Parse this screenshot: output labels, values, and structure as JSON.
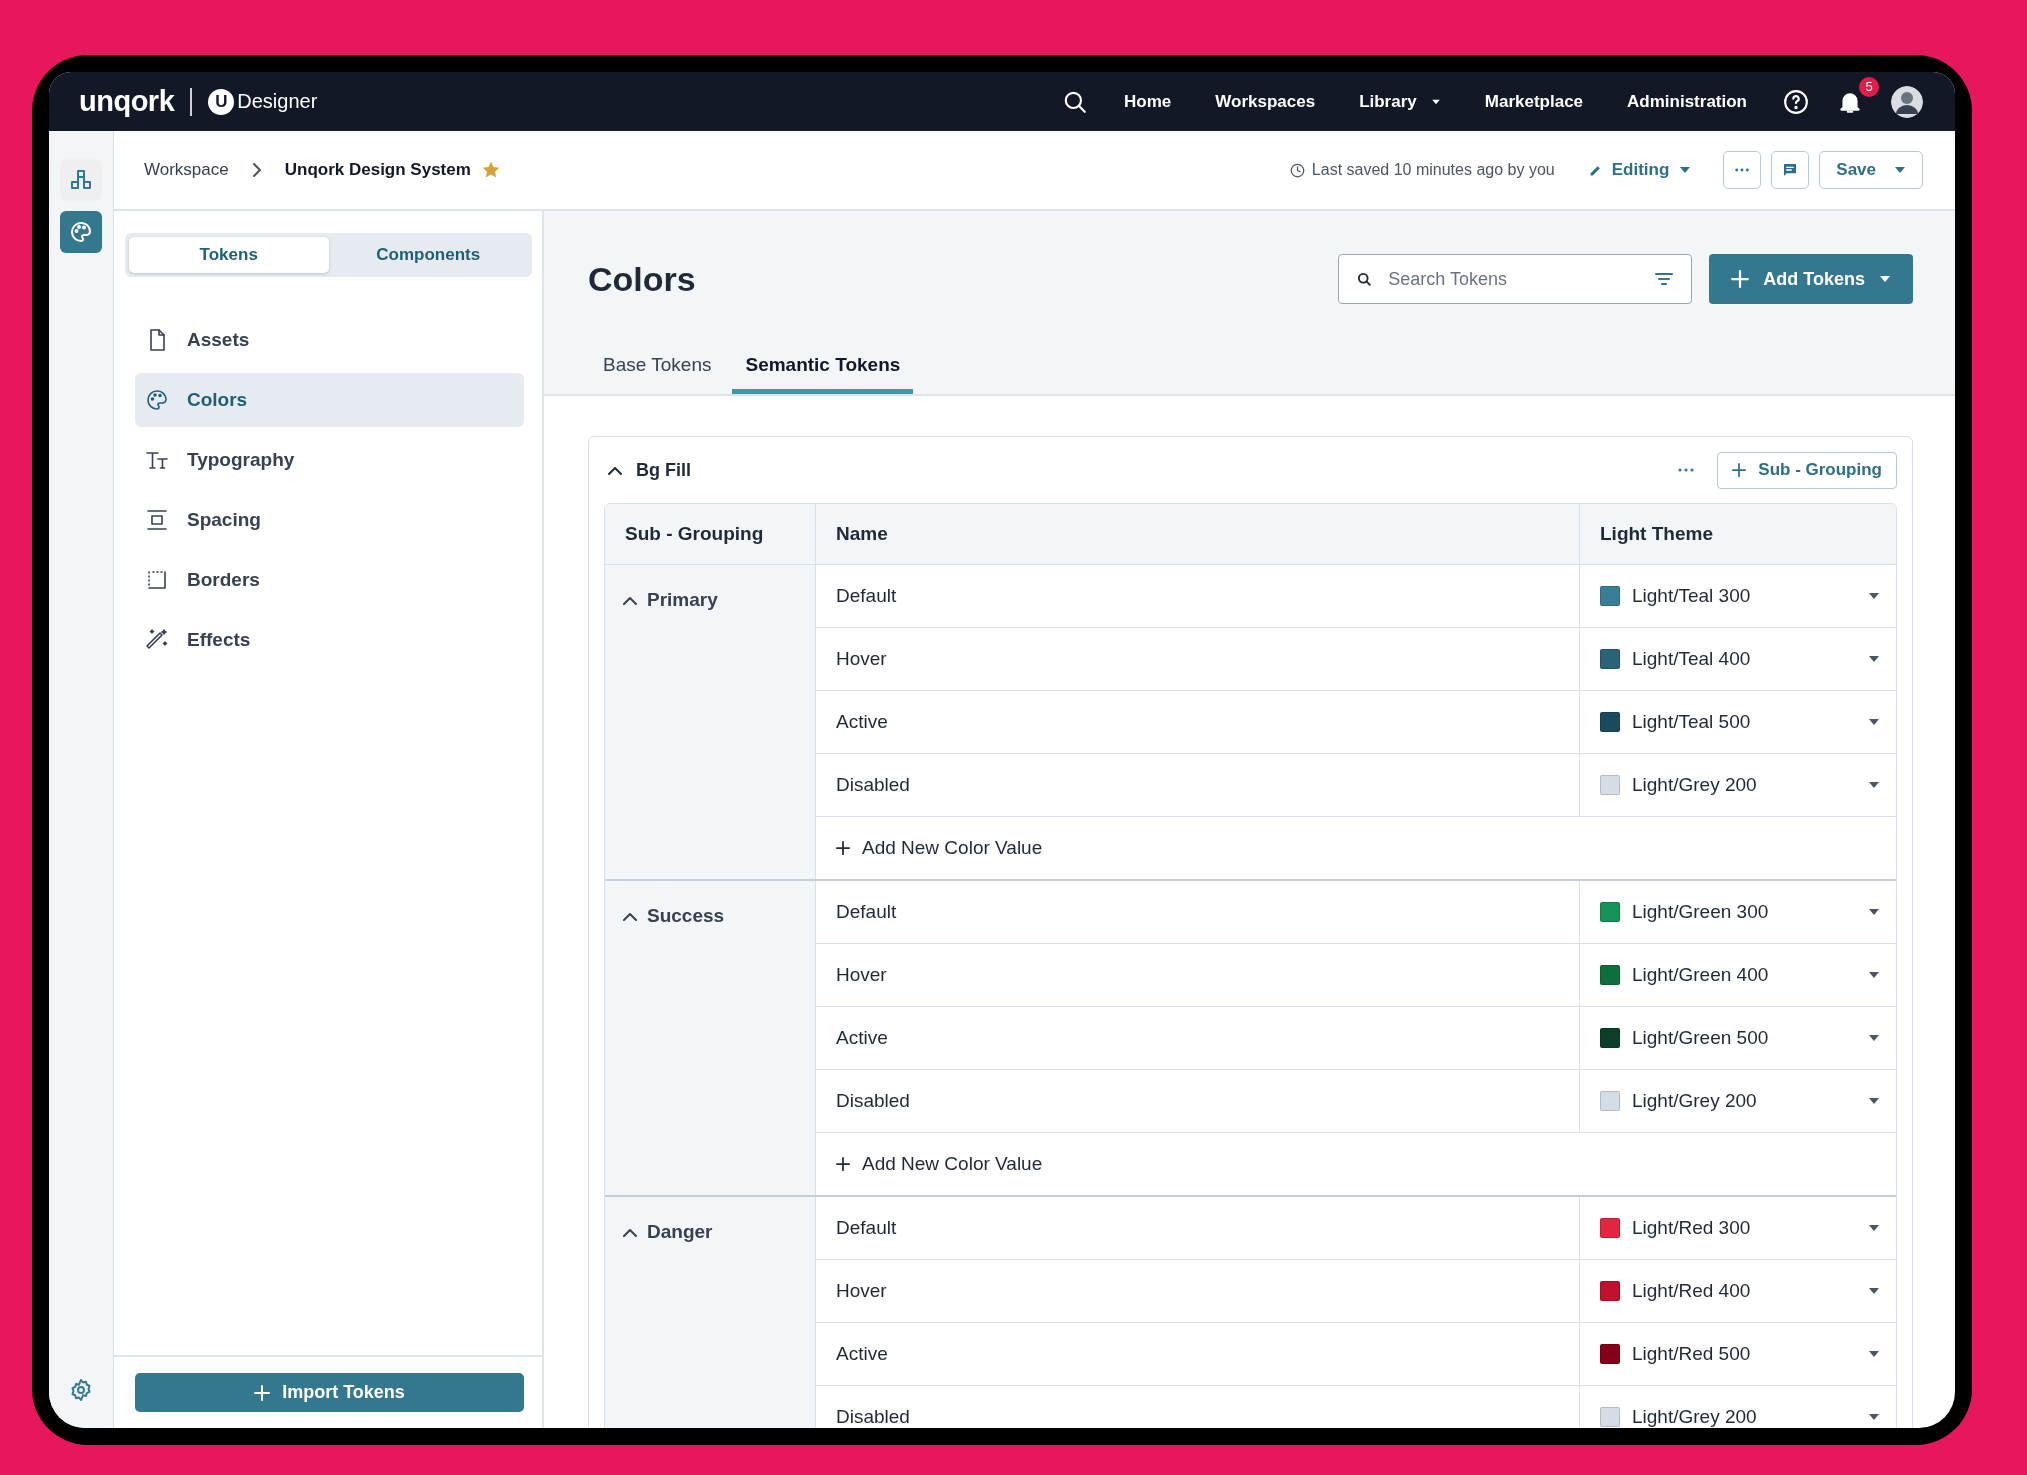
{
  "nav": {
    "logo": "unqork",
    "product_badge": "U",
    "product": "Designer",
    "links": [
      {
        "label": "Home",
        "dropdown": false
      },
      {
        "label": "Workspaces",
        "dropdown": false
      },
      {
        "label": "Library",
        "dropdown": true
      },
      {
        "label": "Marketplace",
        "dropdown": false
      },
      {
        "label": "Administration",
        "dropdown": false
      }
    ],
    "notifications": "5"
  },
  "rail": {
    "items": [
      {
        "kind": "cubes",
        "selected": false
      },
      {
        "kind": "palette",
        "selected": true
      }
    ]
  },
  "header": {
    "breadcrumb": [
      {
        "label": "Workspace",
        "current": false
      },
      {
        "label": "Unqork Design System",
        "current": true
      }
    ],
    "starred": true,
    "last_saved": "Last saved 10 minutes ago by you",
    "mode": "Editing",
    "save": "Save"
  },
  "sidebar": {
    "tabs": [
      {
        "label": "Tokens",
        "selected": true
      },
      {
        "label": "Components",
        "selected": false
      }
    ],
    "items": [
      {
        "label": "Assets",
        "kind": "file",
        "selected": false
      },
      {
        "label": "Colors",
        "kind": "palette",
        "selected": true
      },
      {
        "label": "Typography",
        "kind": "type",
        "selected": false
      },
      {
        "label": "Spacing",
        "kind": "spacing",
        "selected": false
      },
      {
        "label": "Borders",
        "kind": "borders",
        "selected": false
      },
      {
        "label": "Effects",
        "kind": "wand",
        "selected": false
      }
    ],
    "import_button": "Import Tokens"
  },
  "page": {
    "title": "Colors",
    "search": {
      "placeholder": "Search Tokens"
    },
    "add_button": "Add Tokens",
    "tabs": [
      {
        "label": "Base Tokens",
        "selected": false
      },
      {
        "label": "Semantic Tokens",
        "selected": true
      }
    ]
  },
  "group": {
    "title": "Bg Fill",
    "expanded": true,
    "add_button": "Sub - Grouping",
    "columns": [
      "Sub - Grouping",
      "Name",
      "Light Theme"
    ],
    "subgroups": [
      {
        "name": "Primary",
        "expanded": true,
        "add_label": "Add New Color Value",
        "rows": [
          {
            "name": "Default",
            "value": "Light/Teal 300",
            "color": "#3a7d96"
          },
          {
            "name": "Hover",
            "value": "Light/Teal 400",
            "color": "#2a6279"
          },
          {
            "name": "Active",
            "value": "Light/Teal 500",
            "color": "#1b4a5e"
          },
          {
            "name": "Disabled",
            "value": "Light/Grey 200",
            "color": "#d4dde6"
          }
        ]
      },
      {
        "name": "Success",
        "expanded": true,
        "add_label": "Add New Color Value",
        "rows": [
          {
            "name": "Default",
            "value": "Light/Green 300",
            "color": "#17935a"
          },
          {
            "name": "Hover",
            "value": "Light/Green 400",
            "color": "#0e6e3e"
          },
          {
            "name": "Active",
            "value": "Light/Green 500",
            "color": "#0c3f27"
          },
          {
            "name": "Disabled",
            "value": "Light/Grey 200",
            "color": "#d4dde6"
          }
        ]
      },
      {
        "name": "Danger",
        "expanded": true,
        "rows": [
          {
            "name": "Default",
            "value": "Light/Red 300",
            "color": "#e2263f"
          },
          {
            "name": "Hover",
            "value": "Light/Red 400",
            "color": "#c3102f"
          },
          {
            "name": "Active",
            "value": "Light/Red 500",
            "color": "#850018"
          },
          {
            "name": "Disabled",
            "value": "Light/Grey 200",
            "color": "#d4dde6"
          }
        ]
      }
    ]
  }
}
